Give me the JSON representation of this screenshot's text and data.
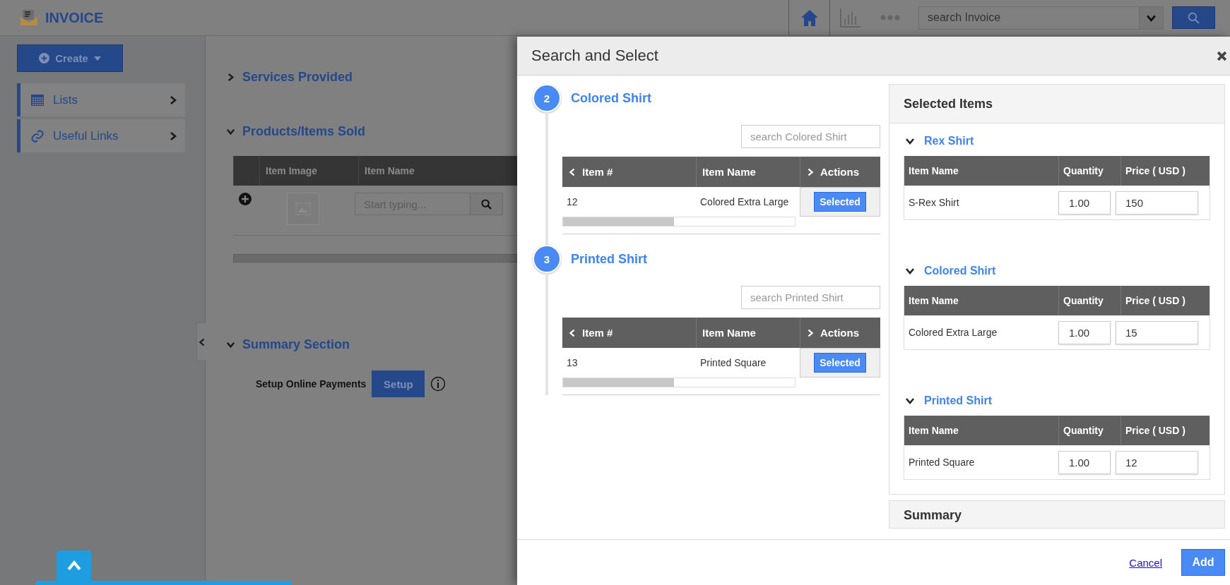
{
  "app": {
    "title": "INVOICE"
  },
  "top_bar": {
    "search_placeholder": "search Invoice"
  },
  "sidebar": {
    "create_button": "Create",
    "items": [
      {
        "label": "Lists",
        "kind": "calendar"
      },
      {
        "label": "Useful Links",
        "kind": "link"
      }
    ]
  },
  "main": {
    "sections": [
      {
        "title": "Services Provided",
        "expanded": false,
        "kind": "plain"
      },
      {
        "title": "Products/Items Sold",
        "expanded": true,
        "kind": "products"
      },
      {
        "title": "Summary Section",
        "expanded": true,
        "kind": "summary"
      }
    ],
    "products_table": {
      "columns": [
        "Item Image",
        "Item Name"
      ],
      "search_placeholder": "Start typing..."
    },
    "online_payments": {
      "label": "Setup Online Payments",
      "button": "Setup"
    }
  },
  "modal": {
    "title": "Search and Select",
    "steps": [
      {
        "number": "2",
        "title": "Colored Shirt",
        "search_placeholder": "search Colored Shirt",
        "columns": [
          "Item #",
          "Item Name",
          "Actions"
        ],
        "rows": [
          {
            "item": "12",
            "name": "Colored Extra Large",
            "action": "Selected"
          }
        ]
      },
      {
        "number": "3",
        "title": "Printed Shirt",
        "search_placeholder": "search Printed Shirt",
        "columns": [
          "Item #",
          "Item Name",
          "Actions"
        ],
        "rows": [
          {
            "item": "13",
            "name": "Printed Square",
            "action": "Selected"
          }
        ]
      }
    ],
    "selected_items": {
      "title": "Selected Items",
      "groups": [
        {
          "name": "Rex Shirt",
          "expanded": true,
          "columns": [
            "Item Name",
            "Quantity",
            "Price ( USD )"
          ],
          "rows": [
            {
              "name": "S-Rex Shirt",
              "quantity": "1.00",
              "price": "150"
            }
          ]
        },
        {
          "name": "Colored Shirt",
          "expanded": true,
          "columns": [
            "Item Name",
            "Quantity",
            "Price ( USD )"
          ],
          "rows": [
            {
              "name": "Colored Extra Large",
              "quantity": "1.00",
              "price": "15"
            }
          ]
        },
        {
          "name": "Printed Shirt",
          "expanded": true,
          "columns": [
            "Item Name",
            "Quantity",
            "Price ( USD )"
          ],
          "rows": [
            {
              "name": "Printed Square",
              "quantity": "1.00",
              "price": "12"
            }
          ]
        }
      ]
    },
    "summary_title": "Summary",
    "footer": {
      "cancel": "Cancel",
      "add": "Add"
    }
  }
}
